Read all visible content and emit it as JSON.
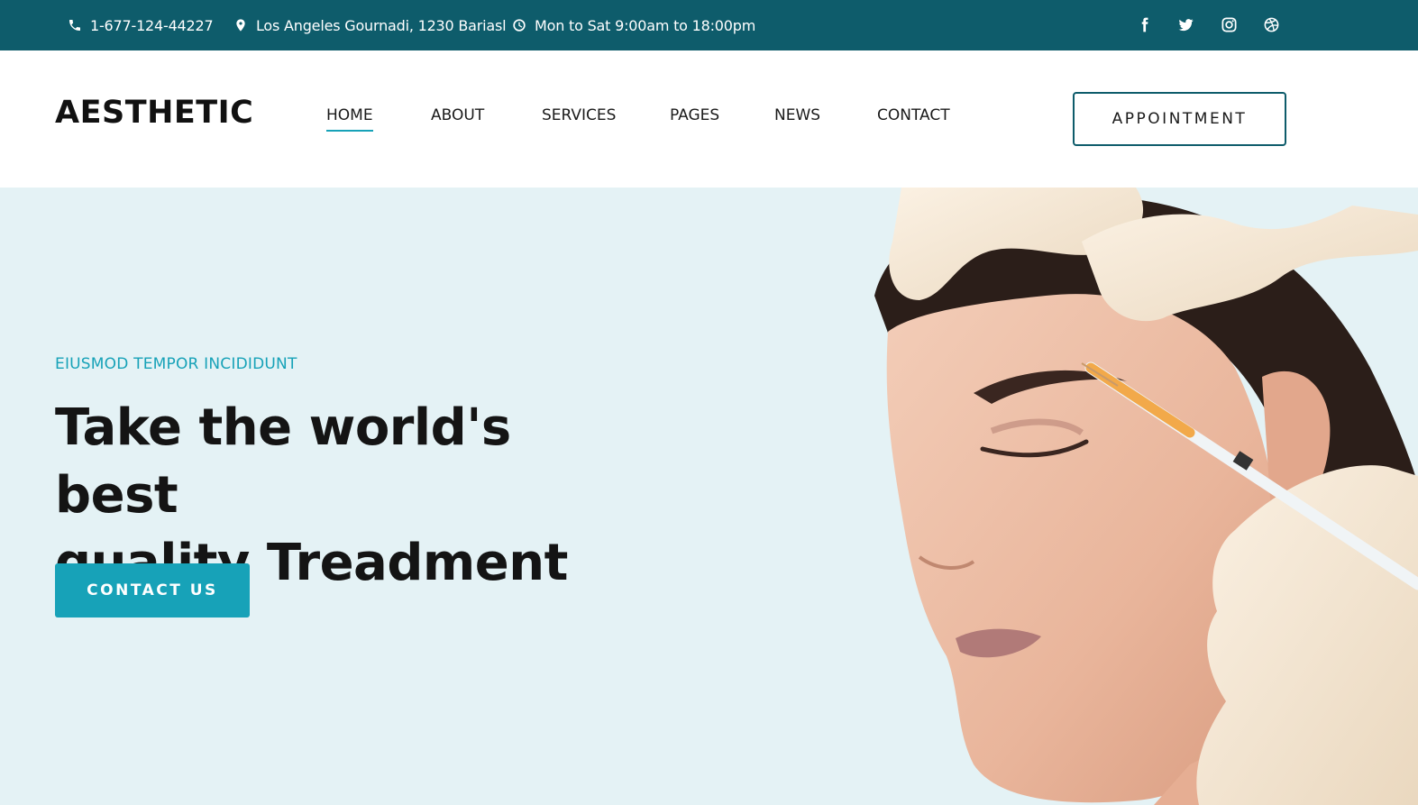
{
  "topbar": {
    "phone": "1-677-124-44227",
    "address": "Los Angeles Gournadi, 1230 Bariasl",
    "hours": "Mon to Sat 9:00am to 18:00pm",
    "social": [
      "facebook-icon",
      "twitter-icon",
      "instagram-icon",
      "dribbble-icon"
    ],
    "bg_color": "#0e5c6b"
  },
  "header": {
    "logo": "AESTHETIC",
    "nav": [
      "HOME",
      "ABOUT",
      "SERVICES",
      "PAGES",
      "NEWS",
      "CONTACT"
    ],
    "active_nav": "HOME",
    "appointment_label": "APPOINTMENT"
  },
  "hero": {
    "subtitle": "EIUSMOD TEMPOR INCIDIDUNT",
    "title_line1": "Take the world's best",
    "title_line2": "quality Treadment",
    "cta_label": "CONTACT US",
    "accent_color": "#17a2b8",
    "bg_color": "#e4f2f5"
  }
}
